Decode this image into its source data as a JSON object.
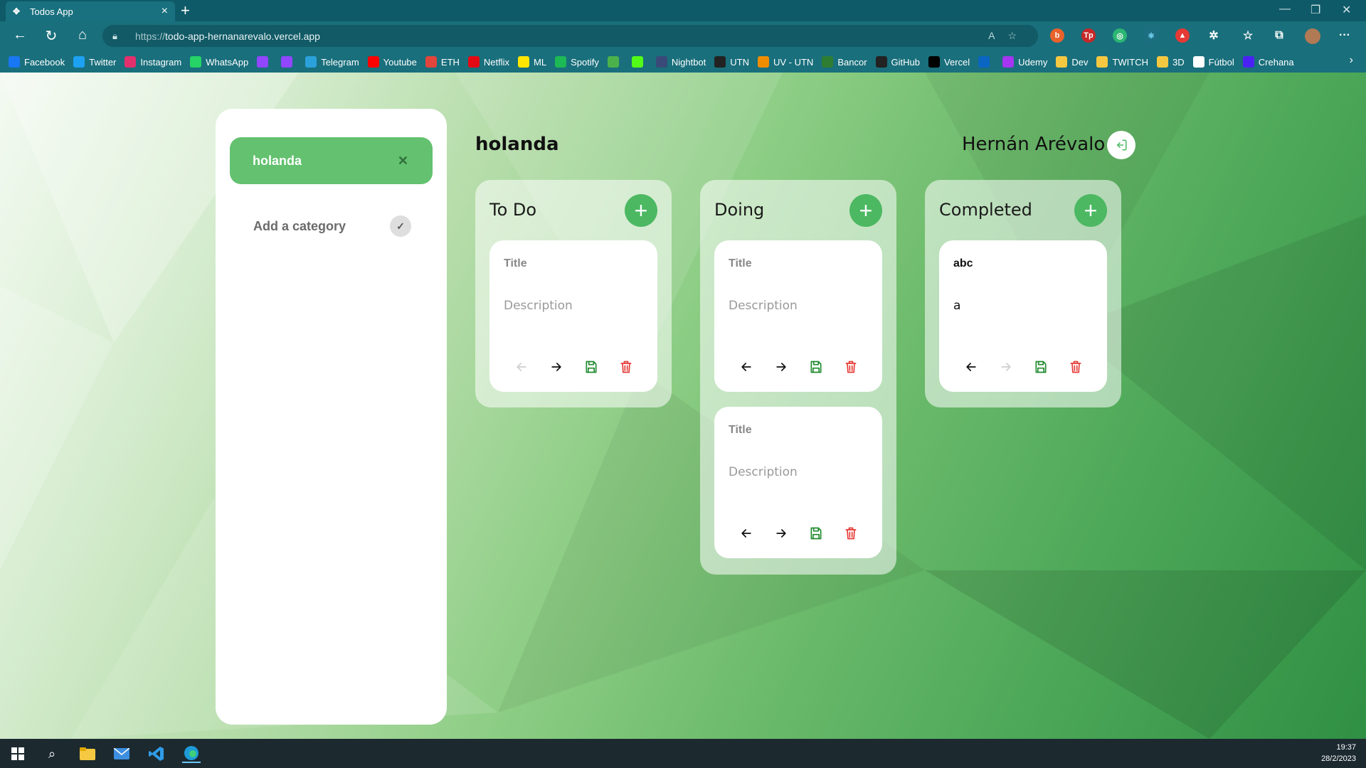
{
  "browser": {
    "tab_title": "Todos App",
    "new_tab_symbol": "+",
    "url_scheme": "https://",
    "url_host": "todo-app-hernanarevalo.vercel.app",
    "bookmarks": [
      {
        "label": "Facebook",
        "icon": "facebook-icon",
        "color": "#1877f2"
      },
      {
        "label": "Twitter",
        "icon": "twitter-icon",
        "color": "#1da1f2"
      },
      {
        "label": "Instagram",
        "icon": "instagram-icon",
        "color": "#e1306c"
      },
      {
        "label": "WhatsApp",
        "icon": "whatsapp-icon",
        "color": "#25d366"
      },
      {
        "label": "",
        "icon": "twitch-icon",
        "color": "#9146ff"
      },
      {
        "label": "",
        "icon": "twitch-icon",
        "color": "#9146ff"
      },
      {
        "label": "Telegram",
        "icon": "telegram-icon",
        "color": "#2aa1da"
      },
      {
        "label": "Youtube",
        "icon": "youtube-icon",
        "color": "#ff0000"
      },
      {
        "label": "ETH",
        "icon": "eth-icon",
        "color": "#e2453c"
      },
      {
        "label": "Netflix",
        "icon": "netflix-icon",
        "color": "#e50914"
      },
      {
        "label": "ML",
        "icon": "mercadolibre-icon",
        "color": "#ffe600"
      },
      {
        "label": "Spotify",
        "icon": "spotify-icon",
        "color": "#1db954"
      },
      {
        "label": "",
        "icon": "gecko-icon",
        "color": "#4bb24b"
      },
      {
        "label": "",
        "icon": "kick-icon",
        "color": "#53fc18"
      },
      {
        "label": "Nightbot",
        "icon": "nightbot-icon",
        "color": "#3a4a78"
      },
      {
        "label": "UTN",
        "icon": "utn-icon",
        "color": "#222222"
      },
      {
        "label": "UV - UTN",
        "icon": "uv-utn-icon",
        "color": "#f08c00"
      },
      {
        "label": "Bancor",
        "icon": "bancor-icon",
        "color": "#2e7d32"
      },
      {
        "label": "GitHub",
        "icon": "github-icon",
        "color": "#222222"
      },
      {
        "label": "Vercel",
        "icon": "vercel-icon",
        "color": "#000000"
      },
      {
        "label": "",
        "icon": "linkedin-icon",
        "color": "#0a66c2"
      },
      {
        "label": "Udemy",
        "icon": "udemy-icon",
        "color": "#a435f0"
      },
      {
        "label": "Dev",
        "icon": "folder-icon",
        "color": "#f5c842"
      },
      {
        "label": "TWITCH",
        "icon": "folder-icon",
        "color": "#f5c842"
      },
      {
        "label": "3D",
        "icon": "folder-icon",
        "color": "#f5c842"
      },
      {
        "label": "Fútbol",
        "icon": "page-icon",
        "color": "#ffffff"
      },
      {
        "label": "Crehana",
        "icon": "crehana-icon",
        "color": "#4b22f4"
      }
    ]
  },
  "sidebar": {
    "active_category": "holanda",
    "add_category_label": "Add a category"
  },
  "board": {
    "title": "holanda",
    "user_name": "Hernán Arévalo",
    "columns": [
      {
        "title": "To Do",
        "cards": [
          {
            "title": "Title",
            "description": "Description",
            "filled": false,
            "back_enabled": false,
            "forward_enabled": true
          }
        ]
      },
      {
        "title": "Doing",
        "cards": [
          {
            "title": "Title",
            "description": "Description",
            "filled": false,
            "back_enabled": true,
            "forward_enabled": true
          },
          {
            "title": "Title",
            "description": "Description",
            "filled": false,
            "back_enabled": true,
            "forward_enabled": true
          }
        ]
      },
      {
        "title": "Completed",
        "cards": [
          {
            "title": "abc",
            "description": "a",
            "filled": true,
            "back_enabled": true,
            "forward_enabled": false
          }
        ]
      }
    ]
  },
  "taskbar": {
    "time": "19:37",
    "date": "28/2/2023"
  },
  "colors": {
    "accent_green": "#4cb862",
    "active_category": "#63c16f",
    "save_green": "#1f8a2e",
    "delete_red": "#e53935"
  }
}
